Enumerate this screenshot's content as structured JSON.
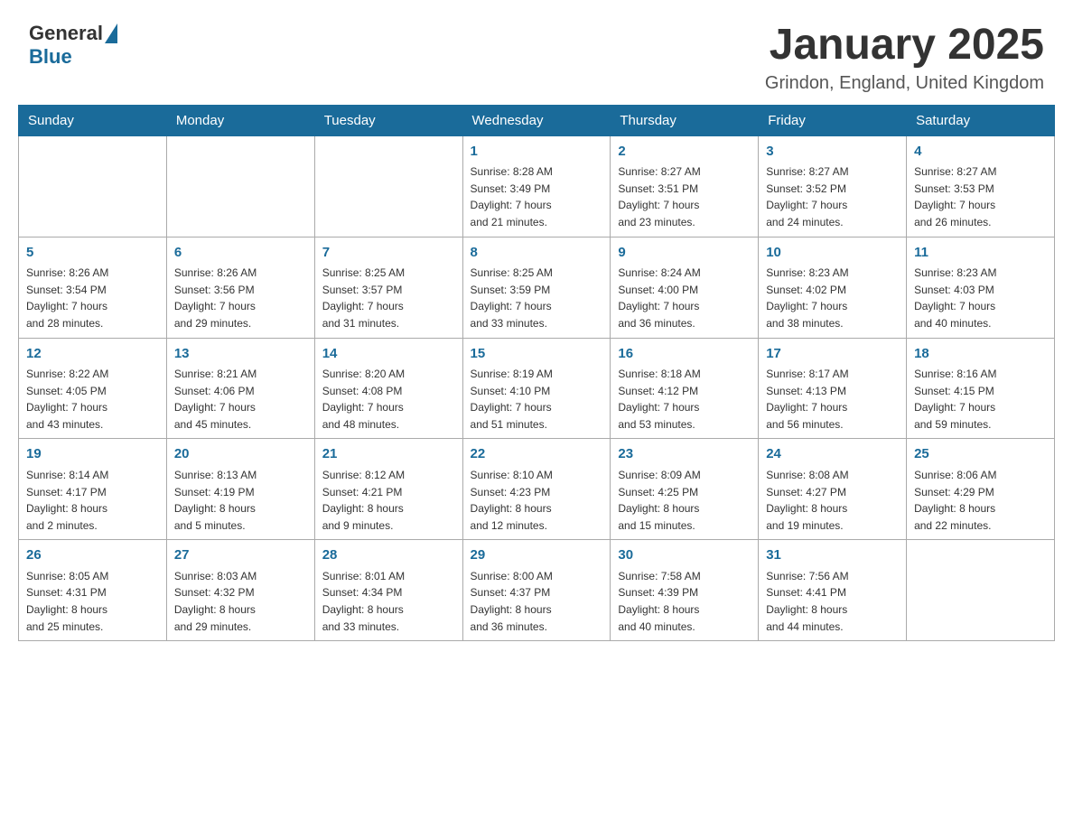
{
  "header": {
    "logo_general": "General",
    "logo_blue": "Blue",
    "month_title": "January 2025",
    "location": "Grindon, England, United Kingdom"
  },
  "days_of_week": [
    "Sunday",
    "Monday",
    "Tuesday",
    "Wednesday",
    "Thursday",
    "Friday",
    "Saturday"
  ],
  "weeks": [
    [
      {
        "day": "",
        "info": ""
      },
      {
        "day": "",
        "info": ""
      },
      {
        "day": "",
        "info": ""
      },
      {
        "day": "1",
        "info": "Sunrise: 8:28 AM\nSunset: 3:49 PM\nDaylight: 7 hours\nand 21 minutes."
      },
      {
        "day": "2",
        "info": "Sunrise: 8:27 AM\nSunset: 3:51 PM\nDaylight: 7 hours\nand 23 minutes."
      },
      {
        "day": "3",
        "info": "Sunrise: 8:27 AM\nSunset: 3:52 PM\nDaylight: 7 hours\nand 24 minutes."
      },
      {
        "day": "4",
        "info": "Sunrise: 8:27 AM\nSunset: 3:53 PM\nDaylight: 7 hours\nand 26 minutes."
      }
    ],
    [
      {
        "day": "5",
        "info": "Sunrise: 8:26 AM\nSunset: 3:54 PM\nDaylight: 7 hours\nand 28 minutes."
      },
      {
        "day": "6",
        "info": "Sunrise: 8:26 AM\nSunset: 3:56 PM\nDaylight: 7 hours\nand 29 minutes."
      },
      {
        "day": "7",
        "info": "Sunrise: 8:25 AM\nSunset: 3:57 PM\nDaylight: 7 hours\nand 31 minutes."
      },
      {
        "day": "8",
        "info": "Sunrise: 8:25 AM\nSunset: 3:59 PM\nDaylight: 7 hours\nand 33 minutes."
      },
      {
        "day": "9",
        "info": "Sunrise: 8:24 AM\nSunset: 4:00 PM\nDaylight: 7 hours\nand 36 minutes."
      },
      {
        "day": "10",
        "info": "Sunrise: 8:23 AM\nSunset: 4:02 PM\nDaylight: 7 hours\nand 38 minutes."
      },
      {
        "day": "11",
        "info": "Sunrise: 8:23 AM\nSunset: 4:03 PM\nDaylight: 7 hours\nand 40 minutes."
      }
    ],
    [
      {
        "day": "12",
        "info": "Sunrise: 8:22 AM\nSunset: 4:05 PM\nDaylight: 7 hours\nand 43 minutes."
      },
      {
        "day": "13",
        "info": "Sunrise: 8:21 AM\nSunset: 4:06 PM\nDaylight: 7 hours\nand 45 minutes."
      },
      {
        "day": "14",
        "info": "Sunrise: 8:20 AM\nSunset: 4:08 PM\nDaylight: 7 hours\nand 48 minutes."
      },
      {
        "day": "15",
        "info": "Sunrise: 8:19 AM\nSunset: 4:10 PM\nDaylight: 7 hours\nand 51 minutes."
      },
      {
        "day": "16",
        "info": "Sunrise: 8:18 AM\nSunset: 4:12 PM\nDaylight: 7 hours\nand 53 minutes."
      },
      {
        "day": "17",
        "info": "Sunrise: 8:17 AM\nSunset: 4:13 PM\nDaylight: 7 hours\nand 56 minutes."
      },
      {
        "day": "18",
        "info": "Sunrise: 8:16 AM\nSunset: 4:15 PM\nDaylight: 7 hours\nand 59 minutes."
      }
    ],
    [
      {
        "day": "19",
        "info": "Sunrise: 8:14 AM\nSunset: 4:17 PM\nDaylight: 8 hours\nand 2 minutes."
      },
      {
        "day": "20",
        "info": "Sunrise: 8:13 AM\nSunset: 4:19 PM\nDaylight: 8 hours\nand 5 minutes."
      },
      {
        "day": "21",
        "info": "Sunrise: 8:12 AM\nSunset: 4:21 PM\nDaylight: 8 hours\nand 9 minutes."
      },
      {
        "day": "22",
        "info": "Sunrise: 8:10 AM\nSunset: 4:23 PM\nDaylight: 8 hours\nand 12 minutes."
      },
      {
        "day": "23",
        "info": "Sunrise: 8:09 AM\nSunset: 4:25 PM\nDaylight: 8 hours\nand 15 minutes."
      },
      {
        "day": "24",
        "info": "Sunrise: 8:08 AM\nSunset: 4:27 PM\nDaylight: 8 hours\nand 19 minutes."
      },
      {
        "day": "25",
        "info": "Sunrise: 8:06 AM\nSunset: 4:29 PM\nDaylight: 8 hours\nand 22 minutes."
      }
    ],
    [
      {
        "day": "26",
        "info": "Sunrise: 8:05 AM\nSunset: 4:31 PM\nDaylight: 8 hours\nand 25 minutes."
      },
      {
        "day": "27",
        "info": "Sunrise: 8:03 AM\nSunset: 4:32 PM\nDaylight: 8 hours\nand 29 minutes."
      },
      {
        "day": "28",
        "info": "Sunrise: 8:01 AM\nSunset: 4:34 PM\nDaylight: 8 hours\nand 33 minutes."
      },
      {
        "day": "29",
        "info": "Sunrise: 8:00 AM\nSunset: 4:37 PM\nDaylight: 8 hours\nand 36 minutes."
      },
      {
        "day": "30",
        "info": "Sunrise: 7:58 AM\nSunset: 4:39 PM\nDaylight: 8 hours\nand 40 minutes."
      },
      {
        "day": "31",
        "info": "Sunrise: 7:56 AM\nSunset: 4:41 PM\nDaylight: 8 hours\nand 44 minutes."
      },
      {
        "day": "",
        "info": ""
      }
    ]
  ]
}
